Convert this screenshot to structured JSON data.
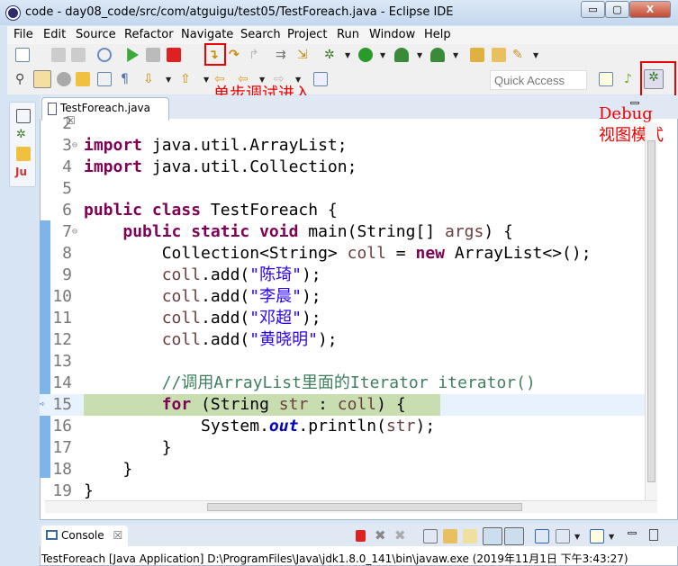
{
  "window": {
    "title": "code - day08_code/src/com/atguigu/test05/TestForeach.java - Eclipse IDE",
    "min": "▭",
    "max": "▢",
    "close": "X"
  },
  "menu": [
    "File",
    "Edit",
    "Source",
    "Refactor",
    "Navigate",
    "Search",
    "Project",
    "Run",
    "Window",
    "Help"
  ],
  "toolbar": {
    "quick_access_placeholder": "Quick Access"
  },
  "annotations": {
    "step_into": "单步调试进入",
    "debug_line1": "Debug",
    "debug_line2": "视图模式",
    "color": "#e00000"
  },
  "editor": {
    "tab_label": "TestForeach.java",
    "tab_close": "☒",
    "lines": [
      {
        "n": "2",
        "t": []
      },
      {
        "n": "3",
        "t": [
          [
            "import",
            "kw"
          ],
          [
            " java.util.ArrayList;",
            ""
          ]
        ]
      },
      {
        "n": "4",
        "t": [
          [
            "import",
            "kw"
          ],
          [
            " java.util.Collection;",
            ""
          ]
        ]
      },
      {
        "n": "5",
        "t": []
      },
      {
        "n": "6",
        "t": [
          [
            "public class",
            "kw"
          ],
          [
            " TestForeach {",
            ""
          ]
        ]
      },
      {
        "n": "7",
        "t": [
          [
            "    ",
            ""
          ],
          [
            "public static void",
            "kw"
          ],
          [
            " main(String[] ",
            ""
          ],
          [
            "args",
            "var"
          ],
          [
            ") {",
            ""
          ]
        ]
      },
      {
        "n": "8",
        "t": [
          [
            "        Collection<String> ",
            ""
          ],
          [
            "coll",
            "var"
          ],
          [
            " = ",
            ""
          ],
          [
            "new",
            "kw"
          ],
          [
            " ArrayList<>();",
            ""
          ]
        ]
      },
      {
        "n": "9",
        "t": [
          [
            "        ",
            ""
          ],
          [
            "coll",
            "var"
          ],
          [
            ".add(",
            ""
          ],
          [
            "\"陈琦\"",
            "str"
          ],
          [
            ");",
            ""
          ]
        ]
      },
      {
        "n": "10",
        "t": [
          [
            "        ",
            ""
          ],
          [
            "coll",
            "var"
          ],
          [
            ".add(",
            ""
          ],
          [
            "\"李晨\"",
            "str"
          ],
          [
            ");",
            ""
          ]
        ]
      },
      {
        "n": "11",
        "t": [
          [
            "        ",
            ""
          ],
          [
            "coll",
            "var"
          ],
          [
            ".add(",
            ""
          ],
          [
            "\"邓超\"",
            "str"
          ],
          [
            ");",
            ""
          ]
        ]
      },
      {
        "n": "12",
        "t": [
          [
            "        ",
            ""
          ],
          [
            "coll",
            "var"
          ],
          [
            ".add(",
            ""
          ],
          [
            "\"黄晓明\"",
            "str"
          ],
          [
            ");",
            ""
          ]
        ]
      },
      {
        "n": "13",
        "t": []
      },
      {
        "n": "14",
        "t": [
          [
            "        //调用ArrayList里面的Iterator iterator()",
            "cm"
          ]
        ]
      },
      {
        "n": "15",
        "t": [
          [
            "        ",
            ""
          ],
          [
            "for",
            "kw"
          ],
          [
            " (String ",
            ""
          ],
          [
            "str",
            "var"
          ],
          [
            " : ",
            ""
          ],
          [
            "coll",
            "var"
          ],
          [
            ") {",
            ""
          ]
        ]
      },
      {
        "n": "16",
        "t": [
          [
            "            System.",
            ""
          ],
          [
            "out",
            "fld"
          ],
          [
            ".println(",
            ""
          ],
          [
            "str",
            "var"
          ],
          [
            ");",
            ""
          ]
        ]
      },
      {
        "n": "17",
        "t": [
          [
            "        }",
            ""
          ]
        ]
      },
      {
        "n": "18",
        "t": [
          [
            "    }",
            ""
          ]
        ]
      },
      {
        "n": "19",
        "t": [
          [
            "}",
            ""
          ]
        ]
      }
    ],
    "current_line": "15",
    "debug_highlight": "#c8deb0",
    "current_line_bg": "#e8f2fe"
  },
  "console": {
    "tab_label": "Console",
    "tab_close": "☒",
    "text": "TestForeach [Java Application] D:\\ProgramFiles\\Java\\jdk1.8.0_141\\bin\\javaw.exe (2019年11月1日 下午3:43:27)"
  }
}
